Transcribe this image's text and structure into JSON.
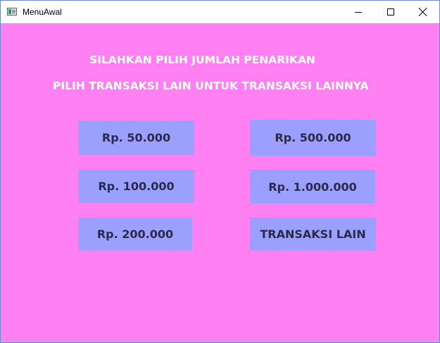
{
  "window": {
    "title": "MenuAwal"
  },
  "main": {
    "heading_1": "SILAHKAN PILIH JUMLAH PENARIKAN",
    "heading_2": "PILIH TRANSAKSI LAIN UNTUK TRANSAKSI LAINNYA",
    "buttons": {
      "amount_50000": "Rp. 50.000",
      "amount_500000": "Rp. 500.000",
      "amount_100000": "Rp. 100.000",
      "amount_1000000": "Rp. 1.000.000",
      "amount_200000": "Rp. 200.000",
      "other_transaction": "TRANSAKSI LAIN"
    }
  },
  "colors": {
    "background": "#ff80f3",
    "button": "#9ba0ff",
    "heading_text": "#ffffff",
    "button_text": "#2b2a4a"
  }
}
